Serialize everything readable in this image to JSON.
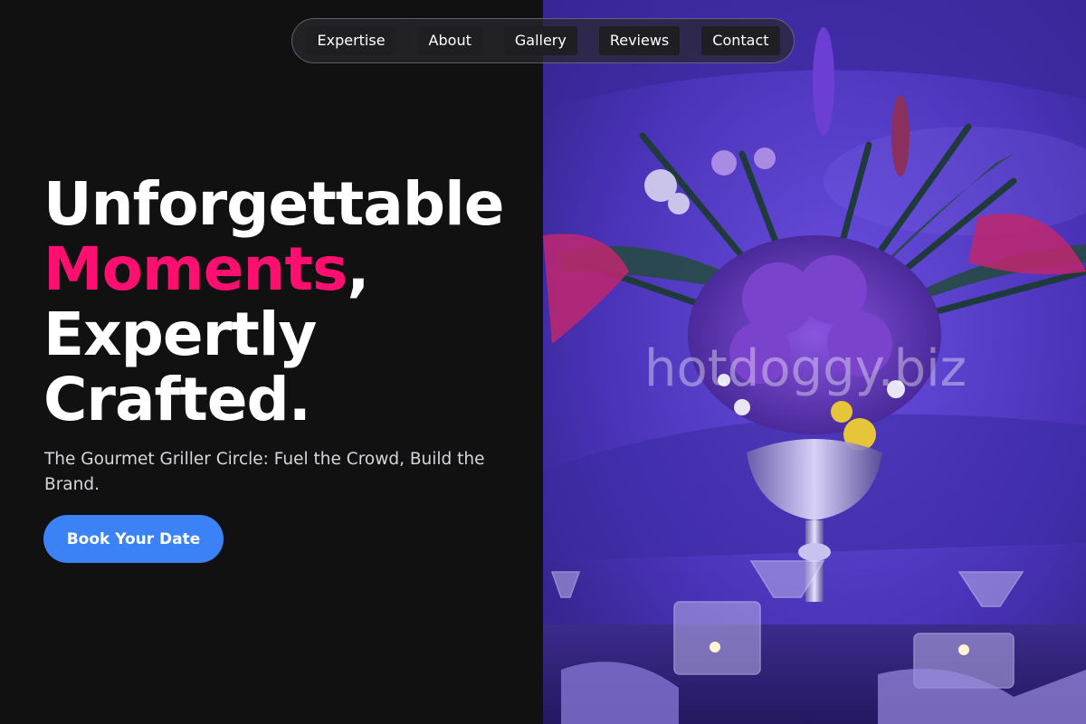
{
  "nav": {
    "items": [
      {
        "label": "Expertise"
      },
      {
        "label": "About"
      },
      {
        "label": "Gallery"
      },
      {
        "label": "Reviews"
      },
      {
        "label": "Contact"
      }
    ]
  },
  "hero": {
    "line1": "Unforgettable",
    "line2_accent": "Moments",
    "line2_rest": ",",
    "line3": "Expertly",
    "line4": "Crafted.",
    "subtitle": "The Gourmet Griller Circle: Fuel the Crowd, Build the Brand.",
    "cta_label": "Book Your Date"
  },
  "image": {
    "watermark": "hotdoggy.biz"
  },
  "colors": {
    "background": "#111112",
    "accent_pink": "#ff0f6f",
    "cta_blue": "#3b82f6",
    "text_white": "#ffffff",
    "subtitle_gray": "#d6d6dc",
    "photo_purple": "#5b3fc4"
  }
}
